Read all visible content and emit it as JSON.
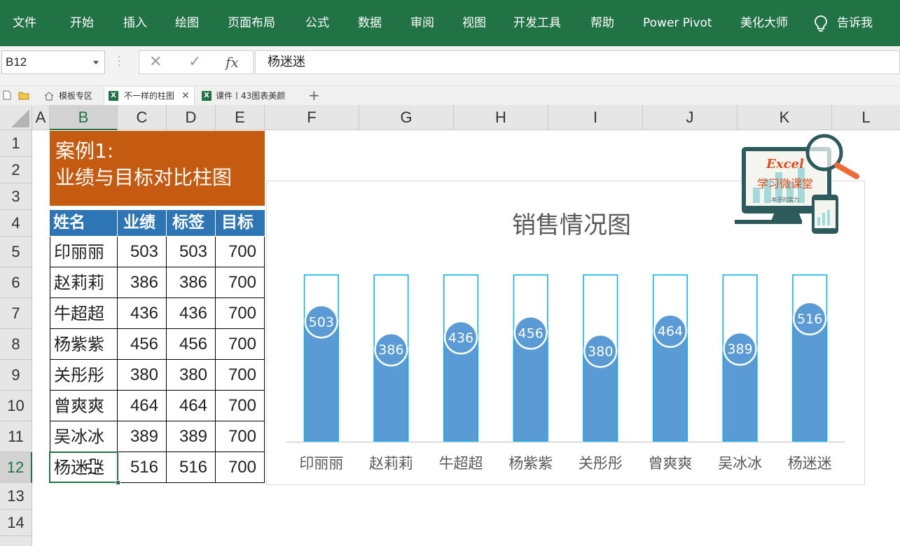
{
  "ribbon": {
    "tabs": [
      "文件",
      "开始",
      "插入",
      "绘图",
      "页面布局",
      "公式",
      "数据",
      "审阅",
      "视图",
      "开发工具",
      "帮助",
      "Power Pivot",
      "美化大师"
    ],
    "tell_me": "告诉我"
  },
  "formula_bar": {
    "name_box": "B12",
    "fx_label": "fx",
    "content": "杨迷迷"
  },
  "doc_tabs": [
    {
      "label": "模板专区"
    },
    {
      "label": "不一样的柱图"
    },
    {
      "label": "课件丨43图表美颜"
    }
  ],
  "columns": [
    "A",
    "B",
    "C",
    "D",
    "E",
    "F",
    "G",
    "H",
    "I",
    "J",
    "K",
    "L"
  ],
  "rows": [
    "1",
    "2",
    "3",
    "4",
    "5",
    "6",
    "7",
    "8",
    "9",
    "10",
    "11",
    "12",
    "13",
    "14"
  ],
  "title_block": {
    "line1": "案例1:",
    "line2": "业绩与目标对比柱图"
  },
  "table": {
    "headers": [
      "姓名",
      "业绩",
      "标签",
      "目标"
    ],
    "rows": [
      [
        "印丽丽",
        "503",
        "503",
        "700"
      ],
      [
        "赵莉莉",
        "386",
        "386",
        "700"
      ],
      [
        "牛超超",
        "436",
        "436",
        "700"
      ],
      [
        "杨紫紫",
        "456",
        "456",
        "700"
      ],
      [
        "关彤彤",
        "380",
        "380",
        "700"
      ],
      [
        "曾爽爽",
        "464",
        "464",
        "700"
      ],
      [
        "吴冰冰",
        "389",
        "389",
        "700"
      ],
      [
        "杨迷迷",
        "516",
        "516",
        "700"
      ]
    ]
  },
  "logo": {
    "text": "Excel",
    "subtitle": "学习微课堂",
    "tagline": "本子的实力"
  },
  "chart_data": {
    "type": "bar",
    "title": "销售情况图",
    "categories": [
      "印丽丽",
      "赵莉莉",
      "牛超超",
      "杨紫紫",
      "关彤彤",
      "曾爽爽",
      "吴冰冰",
      "杨迷迷"
    ],
    "series": [
      {
        "values": [
          503,
          386,
          436,
          456,
          380,
          464,
          389,
          516
        ]
      },
      {
        "values": [
          700,
          700,
          700,
          700,
          700,
          700,
          700,
          700
        ]
      }
    ],
    "data_labels": [
      503,
      386,
      436,
      456,
      380,
      464,
      389,
      516
    ],
    "ylim": [
      0,
      700
    ],
    "grid": false,
    "legend": "none",
    "colors": {
      "performance": "#5b9bd5",
      "target_outline": "#00b0f0",
      "label_border": "#ffffff"
    }
  },
  "colors": {
    "ribbon": "#217346",
    "title_block": "#c55a11",
    "table_header": "#2e75b6",
    "selection": "#217346"
  }
}
